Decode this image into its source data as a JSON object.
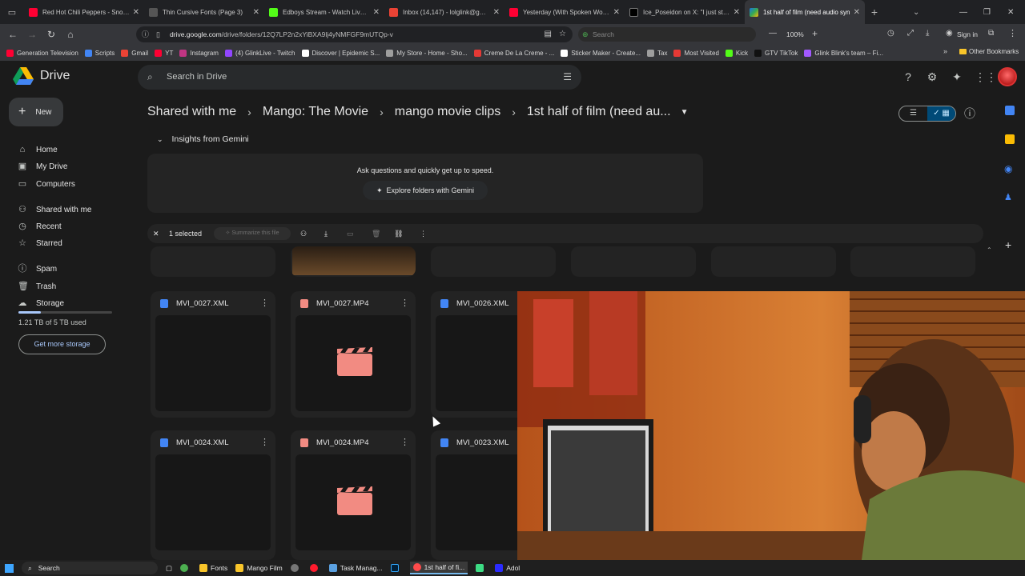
{
  "browser": {
    "tabs": [
      {
        "label": "Red Hot Chili Peppers - Snow (H",
        "color": "#ff0033"
      },
      {
        "label": "Thin Cursive Fonts (Page 3)",
        "color": "#444444"
      },
      {
        "label": "Edboys Stream - Watch Live on",
        "color": "#53fc18"
      },
      {
        "label": "Inbox (14,147) - lolglink@gmail",
        "color": "#ea4335"
      },
      {
        "label": "Yesterday (With Spoken Word I",
        "color": "#ff0033"
      },
      {
        "label": "Ice_Poseidon on X: \"I just strea",
        "color": "#000000"
      },
      {
        "label": "1st half of film (need audio syn",
        "color": "#1a73e8",
        "active": true
      }
    ],
    "url_domain": "drive.google.com",
    "url_path": "/drive/folders/12Q7LP2n2xYiBXA9lj4yNMFGF9mUTQp-v",
    "search_placeholder": "Search",
    "zoom": "100%",
    "signin": "Sign in",
    "bookmarks": [
      {
        "label": "Generation Television",
        "color": "#ff0033"
      },
      {
        "label": "Scripts",
        "color": "#4285f4"
      },
      {
        "label": "Gmail",
        "color": "#ea4335"
      },
      {
        "label": "YT",
        "color": "#ff0033"
      },
      {
        "label": "Instagram",
        "color": "#c13584"
      },
      {
        "label": "(4) GlinkLive - Twitch",
        "color": "#9146ff"
      },
      {
        "label": "Discover | Epidemic S...",
        "color": "#ffffff"
      },
      {
        "label": "My Store - Home - Sho...",
        "color": "#9e9e9e"
      },
      {
        "label": "Creme De La Creme - ...",
        "color": "#e53935"
      },
      {
        "label": "Sticker Maker - Create...",
        "color": "#ffffff"
      },
      {
        "label": "Tax",
        "color": "#9e9e9e"
      },
      {
        "label": "Most Visited",
        "color": "#e53935"
      },
      {
        "label": "Kick",
        "color": "#53fc18"
      },
      {
        "label": "GTV TikTok",
        "color": "#111111"
      },
      {
        "label": "Glink Blink's team – Fi...",
        "color": "#a259ff"
      }
    ],
    "other_bookmarks": "Other Bookmarks"
  },
  "drive": {
    "app_name": "Drive",
    "search_placeholder": "Search in Drive",
    "new_label": "New",
    "nav": [
      {
        "label": "Home",
        "icon": "home-icon"
      },
      {
        "label": "My Drive",
        "icon": "drive-icon"
      },
      {
        "label": "Computers",
        "icon": "computer-icon"
      },
      {
        "label": "Shared with me",
        "icon": "people-icon"
      },
      {
        "label": "Recent",
        "icon": "clock-icon"
      },
      {
        "label": "Starred",
        "icon": "star-icon"
      },
      {
        "label": "Spam",
        "icon": "spam-icon"
      },
      {
        "label": "Trash",
        "icon": "trash-icon"
      },
      {
        "label": "Storage",
        "icon": "cloud-icon"
      }
    ],
    "storage_used": "1.21 TB of 5 TB used",
    "storage_fraction": 0.242,
    "get_more_storage": "Get more storage",
    "breadcrumb": [
      "Shared with me",
      "Mango: The Movie",
      "mango movie clips",
      "1st half of film (need au..."
    ],
    "insights_label": "Insights from Gemini",
    "gemini_prompt": "Ask questions and quickly get up to speed.",
    "explore_label": "Explore folders with Gemini",
    "selection_count": "1 selected",
    "summarize_label": "Summarize this file",
    "files": [
      {
        "name": "MVI_0027.XML",
        "type": "doc"
      },
      {
        "name": "MVI_0027.MP4",
        "type": "video"
      },
      {
        "name": "MVI_0026.XML",
        "type": "doc"
      },
      {
        "name": "MVI_0024.XML",
        "type": "doc"
      },
      {
        "name": "MVI_0024.MP4",
        "type": "video"
      },
      {
        "name": "MVI_0023.XML",
        "type": "doc"
      }
    ],
    "colors": {
      "doc": "#4285f4",
      "video": "#f28b82",
      "accent": "#a8c7fa"
    }
  },
  "taskbar": {
    "search": "Search",
    "items": [
      {
        "label": "Fonts",
        "color": "#f9c52a"
      },
      {
        "label": "Mango Film",
        "color": "#f9c52a"
      },
      {
        "label": "Task Manag...",
        "color": "#5aa0e0"
      },
      {
        "label": "1st half of fi...",
        "color": "#ff4b4b"
      },
      {
        "label": "Adol",
        "color": "#2b2bff"
      }
    ]
  }
}
